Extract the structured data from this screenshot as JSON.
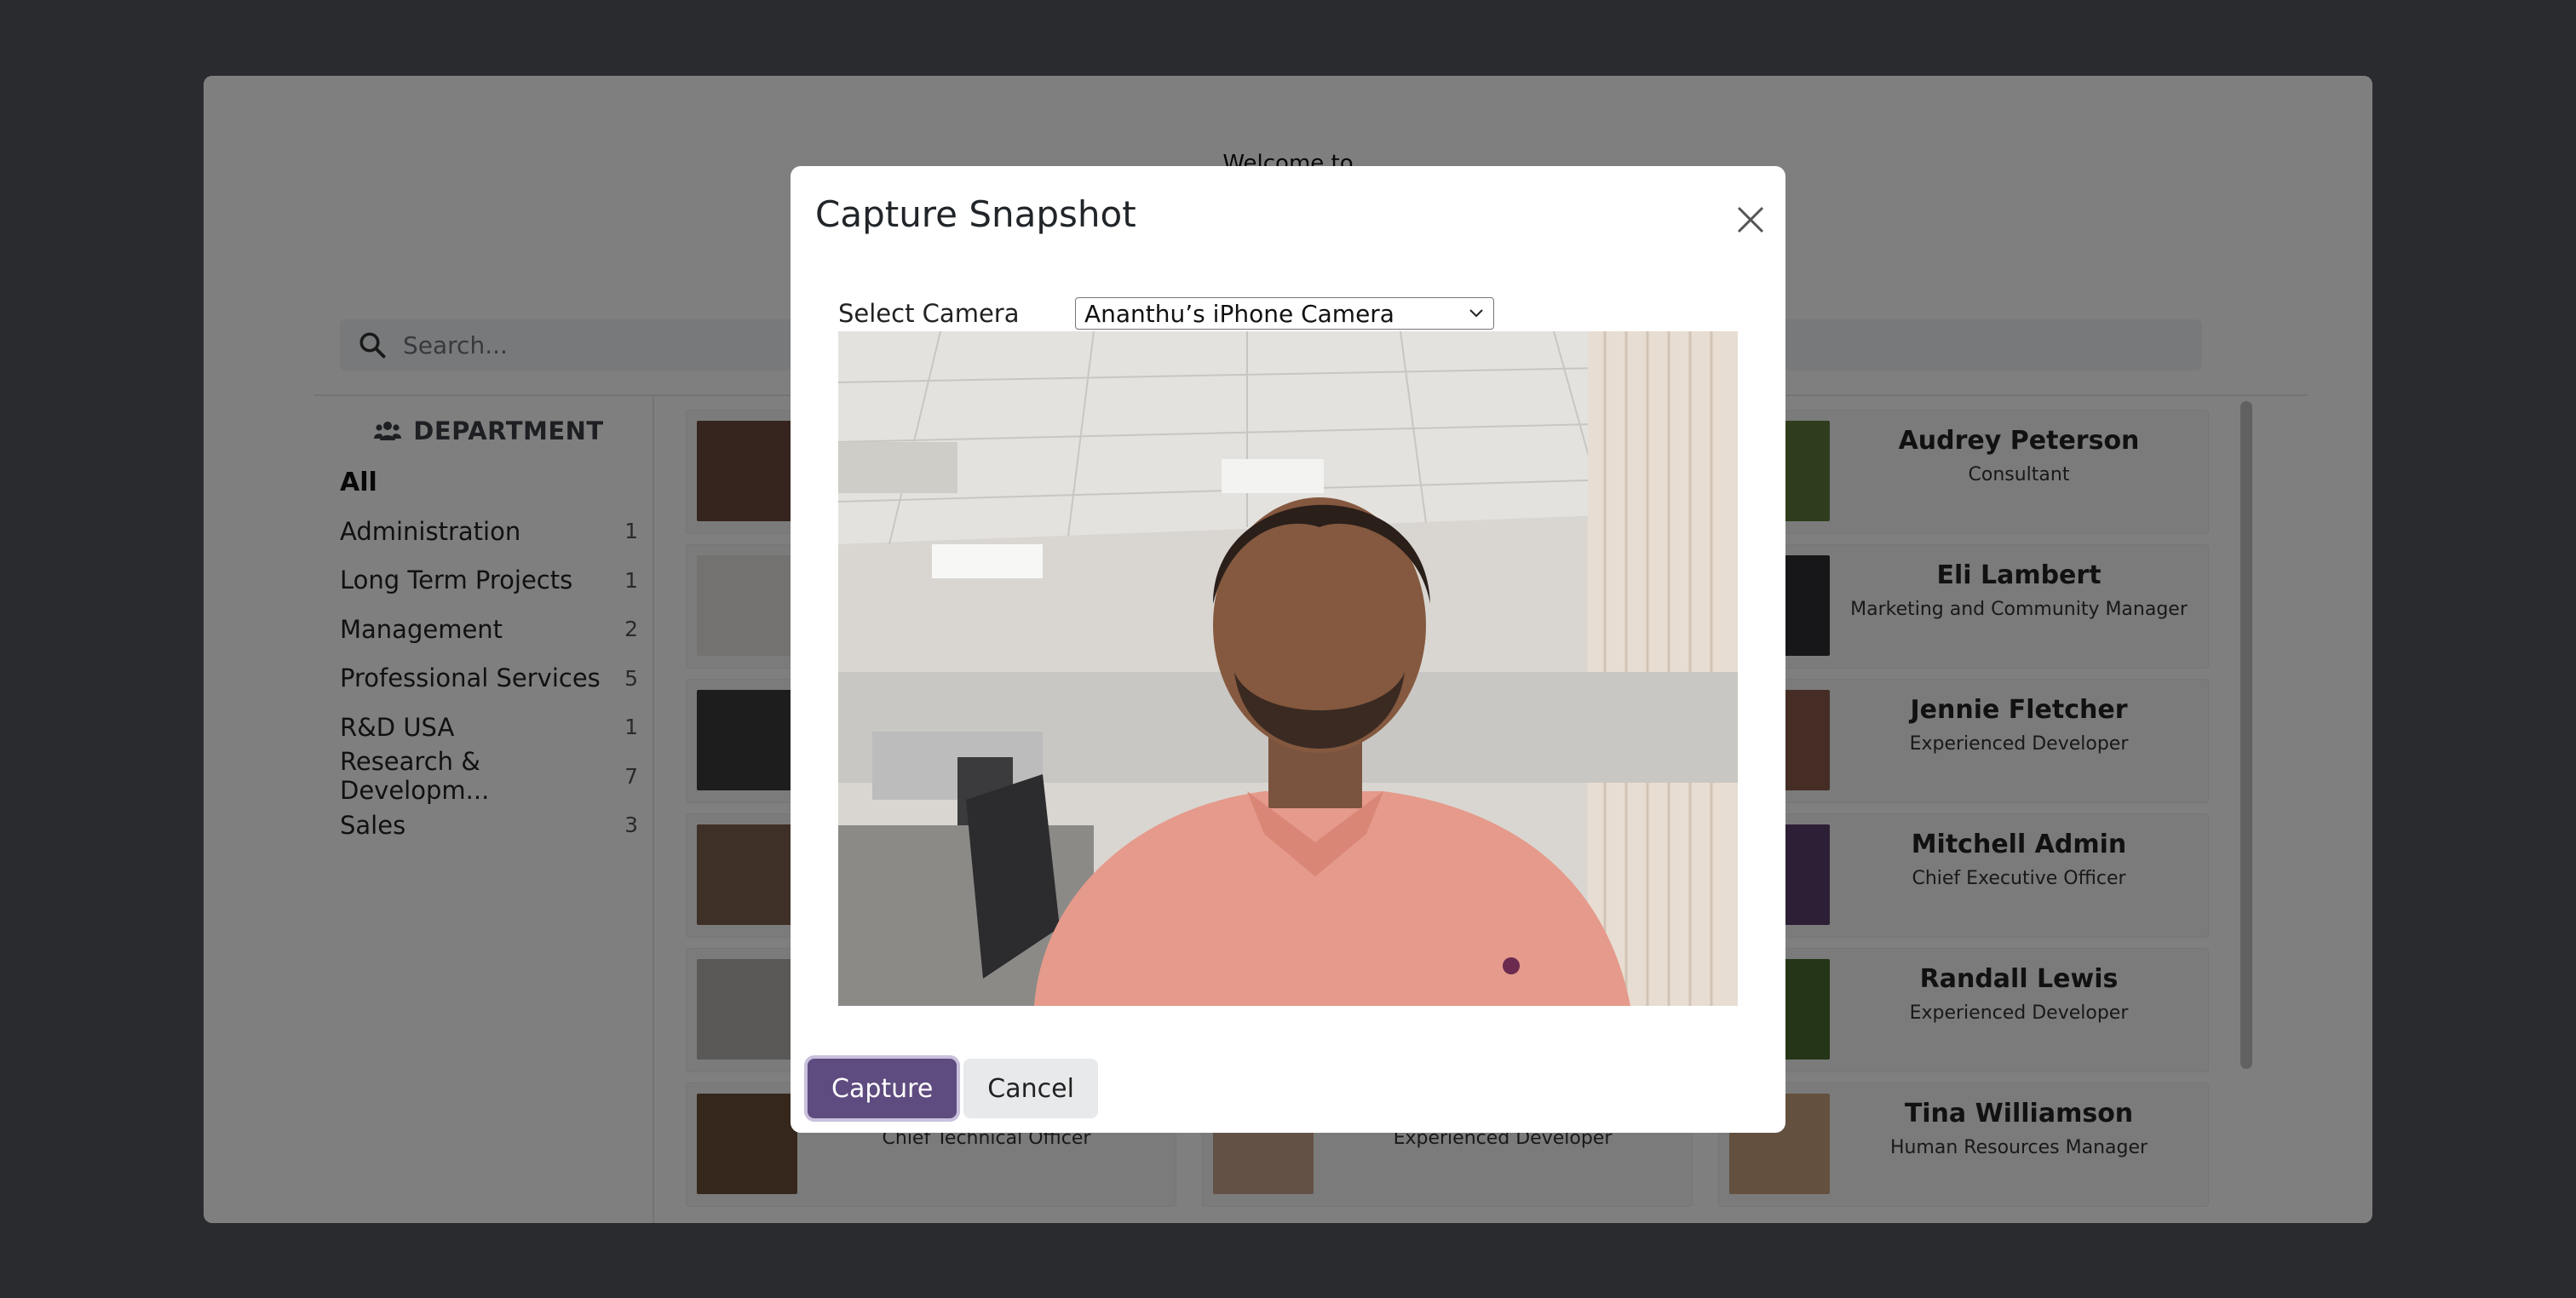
{
  "kiosk": {
    "welcome": "Welcome to",
    "search_placeholder": "Search...",
    "department": {
      "title": "DEPARTMENT",
      "all_label": "All",
      "items": [
        {
          "label": "Administration",
          "count": "1"
        },
        {
          "label": "Long Term Projects",
          "count": "1"
        },
        {
          "label": "Management",
          "count": "2"
        },
        {
          "label": "Professional Services",
          "count": "5"
        },
        {
          "label": "R&D USA",
          "count": "1"
        },
        {
          "label": "Research & Developm...",
          "count": "7"
        },
        {
          "label": "Sales",
          "count": "3"
        }
      ]
    },
    "employees_right": [
      {
        "name": "Audrey Peterson",
        "job": "Consultant"
      },
      {
        "name": "Eli Lambert",
        "job": "Marketing and Community Manager"
      },
      {
        "name": "Jennie Fletcher",
        "job": "Experienced Developer"
      },
      {
        "name": "Mitchell Admin",
        "job": "Chief Executive Officer"
      },
      {
        "name": "Randall Lewis",
        "job": "Experienced Developer"
      },
      {
        "name": "Tina Williamson",
        "job": "Human Resources Manager"
      }
    ],
    "employees_bottom": [
      {
        "job": "Chief Technical Officer"
      },
      {
        "job": "Experienced Developer"
      }
    ]
  },
  "modal": {
    "title": "Capture Snapshot",
    "camera_label": "Select Camera",
    "camera_selected": "Ananthu’s iPhone Camera",
    "capture_label": "Capture",
    "cancel_label": "Cancel"
  },
  "colors": {
    "primary": "#5e4b7f",
    "secondary": "#e8e9eb",
    "backdrop": "#55565d"
  }
}
